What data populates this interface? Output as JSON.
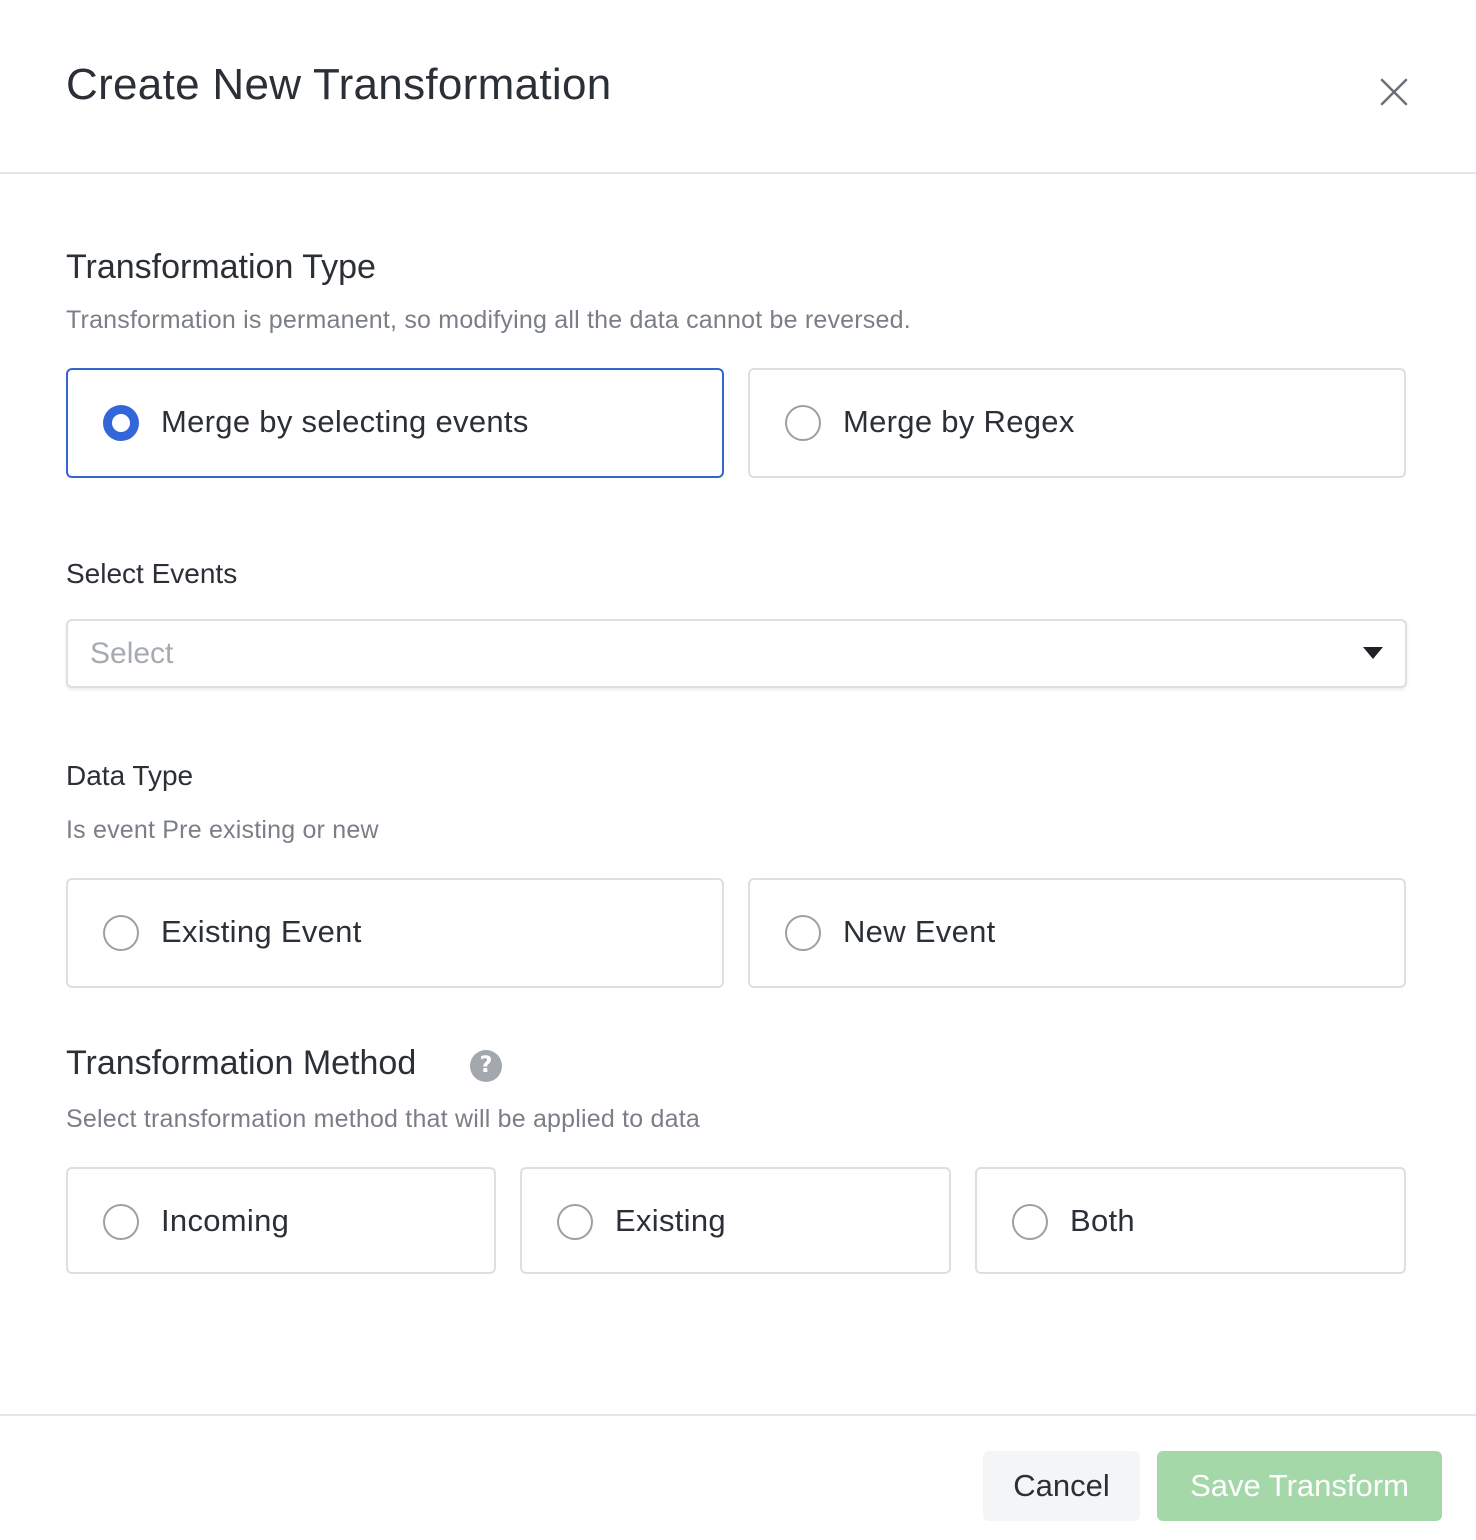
{
  "modal": {
    "title": "Create New Transformation"
  },
  "transformation_type": {
    "title": "Transformation Type",
    "helper": "Transformation is permanent, so modifying all the data cannot be reversed.",
    "options": [
      {
        "label": "Merge by selecting events",
        "selected": true
      },
      {
        "label": "Merge by Regex",
        "selected": false
      }
    ]
  },
  "select_events": {
    "label": "Select Events",
    "placeholder": "Select"
  },
  "data_type": {
    "label": "Data Type",
    "helper": "Is event Pre existing or new",
    "options": [
      {
        "label": "Existing Event",
        "selected": false
      },
      {
        "label": "New Event",
        "selected": false
      }
    ]
  },
  "transformation_method": {
    "title": "Transformation Method",
    "help_icon": "question-mark",
    "helper": "Select transformation method that will be applied to data",
    "options": [
      {
        "label": "Incoming",
        "selected": false
      },
      {
        "label": "Existing",
        "selected": false
      },
      {
        "label": "Both",
        "selected": false
      }
    ]
  },
  "footer": {
    "cancel_label": "Cancel",
    "save_label": "Save Transform"
  },
  "colors": {
    "accent": "#3366d9",
    "save_disabled": "#a5d8a9"
  }
}
